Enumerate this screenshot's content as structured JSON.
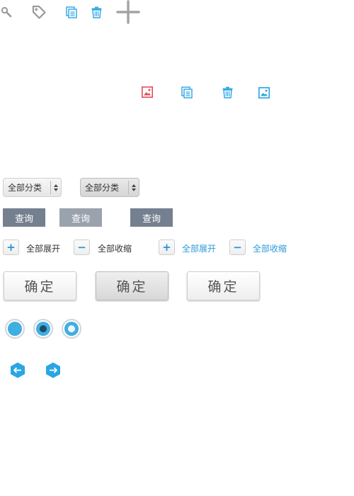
{
  "top_icons": [
    "search-icon",
    "tag-icon",
    "copy-icon",
    "trash-icon",
    "plus-icon"
  ],
  "mid_icons": [
    "image-error-icon",
    "copy-icon",
    "trash-icon",
    "image-icon"
  ],
  "selects": [
    {
      "label": "全部分类",
      "state": "normal"
    },
    {
      "label": "全部分类",
      "state": "active"
    }
  ],
  "query_buttons": [
    {
      "label": "查询",
      "color": "#74808f"
    },
    {
      "label": "查询",
      "color": "#9aa2ad"
    },
    {
      "label": "查询",
      "color": "#74808f"
    }
  ],
  "tree_controls": [
    {
      "symbol": "+",
      "label": "全部展开",
      "style": "normal"
    },
    {
      "symbol": "−",
      "label": "全部收缩",
      "style": "normal"
    },
    {
      "symbol": "+",
      "label": "全部展开",
      "style": "blue"
    },
    {
      "symbol": "−",
      "label": "全部收缩",
      "style": "blue"
    }
  ],
  "confirm_buttons": [
    {
      "label": "确定",
      "state": "normal"
    },
    {
      "label": "确定",
      "state": "pressed"
    },
    {
      "label": "确定",
      "state": "normal"
    }
  ],
  "radios": [
    "unselected",
    "selected-dark",
    "selected-light"
  ],
  "arrows": [
    "arrow-left-icon",
    "arrow-right-icon"
  ],
  "colors": {
    "accent_blue": "#29a6e3",
    "icon_red": "#e84a5a",
    "icon_gray": "#9c9c9c"
  }
}
